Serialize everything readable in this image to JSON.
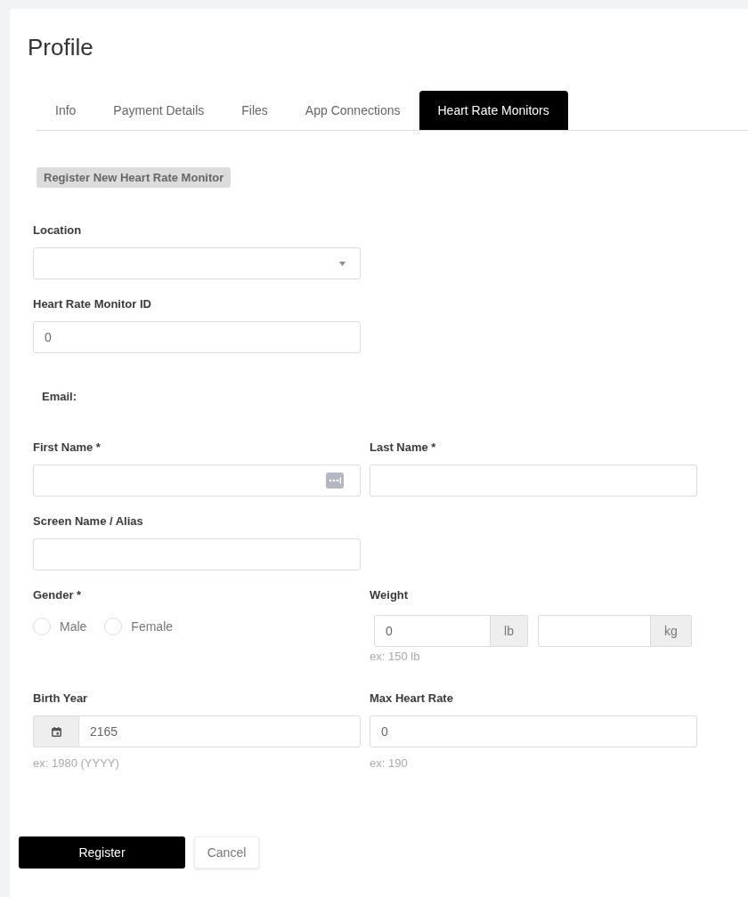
{
  "page": {
    "title": "Profile"
  },
  "tabs": [
    {
      "label": "Info",
      "selected": false
    },
    {
      "label": "Payment Details",
      "selected": false
    },
    {
      "label": "Files",
      "selected": false
    },
    {
      "label": "App Connections",
      "selected": false
    },
    {
      "label": "Heart Rate Monitors",
      "selected": true
    }
  ],
  "section_badge": "Register New Heart Rate Monitor",
  "form": {
    "location": {
      "label": "Location"
    },
    "monitor_id": {
      "label": "Heart Rate Monitor ID",
      "value": "0"
    },
    "email": {
      "label": "Email:"
    },
    "first_name": {
      "label": "First Name *"
    },
    "last_name": {
      "label": "Last Name *"
    },
    "screen_name": {
      "label": "Screen Name / Alias"
    },
    "gender": {
      "label": "Gender *",
      "options": [
        {
          "label": "Male",
          "selected": false
        },
        {
          "label": "Female",
          "selected": false
        }
      ]
    },
    "weight": {
      "label": "Weight",
      "fields": [
        {
          "value": "0",
          "unit": "lb"
        },
        {
          "unit": "kg"
        }
      ],
      "hint": "ex: 150 lb"
    },
    "birth_year": {
      "label": "Birth Year",
      "value": "2165",
      "hint": "ex: 1980 (YYYY)"
    },
    "max_heart_rate": {
      "label": "Max Heart Rate",
      "value": "0",
      "hint": "ex: 190"
    }
  },
  "buttons": [
    {
      "label": "Register",
      "kind": "primary"
    },
    {
      "label": "Cancel",
      "kind": "secondary"
    }
  ]
}
